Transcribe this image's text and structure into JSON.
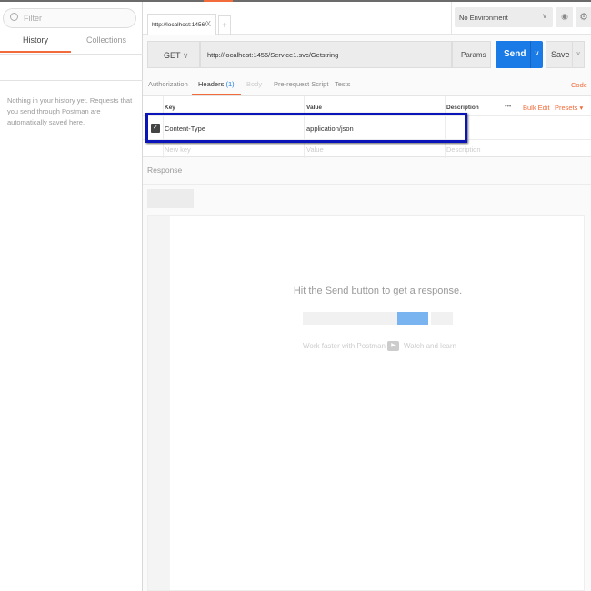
{
  "sidebar": {
    "filter_placeholder": "Filter",
    "tabs": [
      "History",
      "Collections"
    ],
    "empty_message": "Nothing in your history yet. Requests that you send through Postman are automatically saved here."
  },
  "tabs": {
    "request_tab": "http://localhost:1456/",
    "close": "X",
    "add": "+"
  },
  "environment": {
    "selected": "No Environment"
  },
  "request": {
    "method": "GET",
    "url": "http://localhost:1456/Service1.svc/Getstring",
    "params_label": "Params",
    "send_label": "Send",
    "save_label": "Save"
  },
  "request_tabs": {
    "authorization": "Authorization",
    "headers": "Headers",
    "headers_count": "(1)",
    "body": "Body",
    "prerequest": "Pre-request Script",
    "tests": "Tests",
    "code": "Code"
  },
  "headers_table": {
    "columns": [
      "Key",
      "Value",
      "Description"
    ],
    "more": "•••",
    "bulk_edit": "Bulk Edit",
    "presets": "Presets ▾",
    "rows": [
      {
        "key": "Content-Type",
        "value": "application/json",
        "checked": true
      }
    ],
    "placeholder": {
      "key": "New key",
      "value": "Value",
      "description": "Description"
    }
  },
  "response": {
    "label": "Response",
    "hint": "Hit the Send button to get a response.",
    "work_faster": "Work faster with Postman",
    "watch": "Watch and learn"
  },
  "colors": {
    "accent": "#f26b3a",
    "send": "#1a7be6",
    "highlight": "#0a14b8"
  }
}
